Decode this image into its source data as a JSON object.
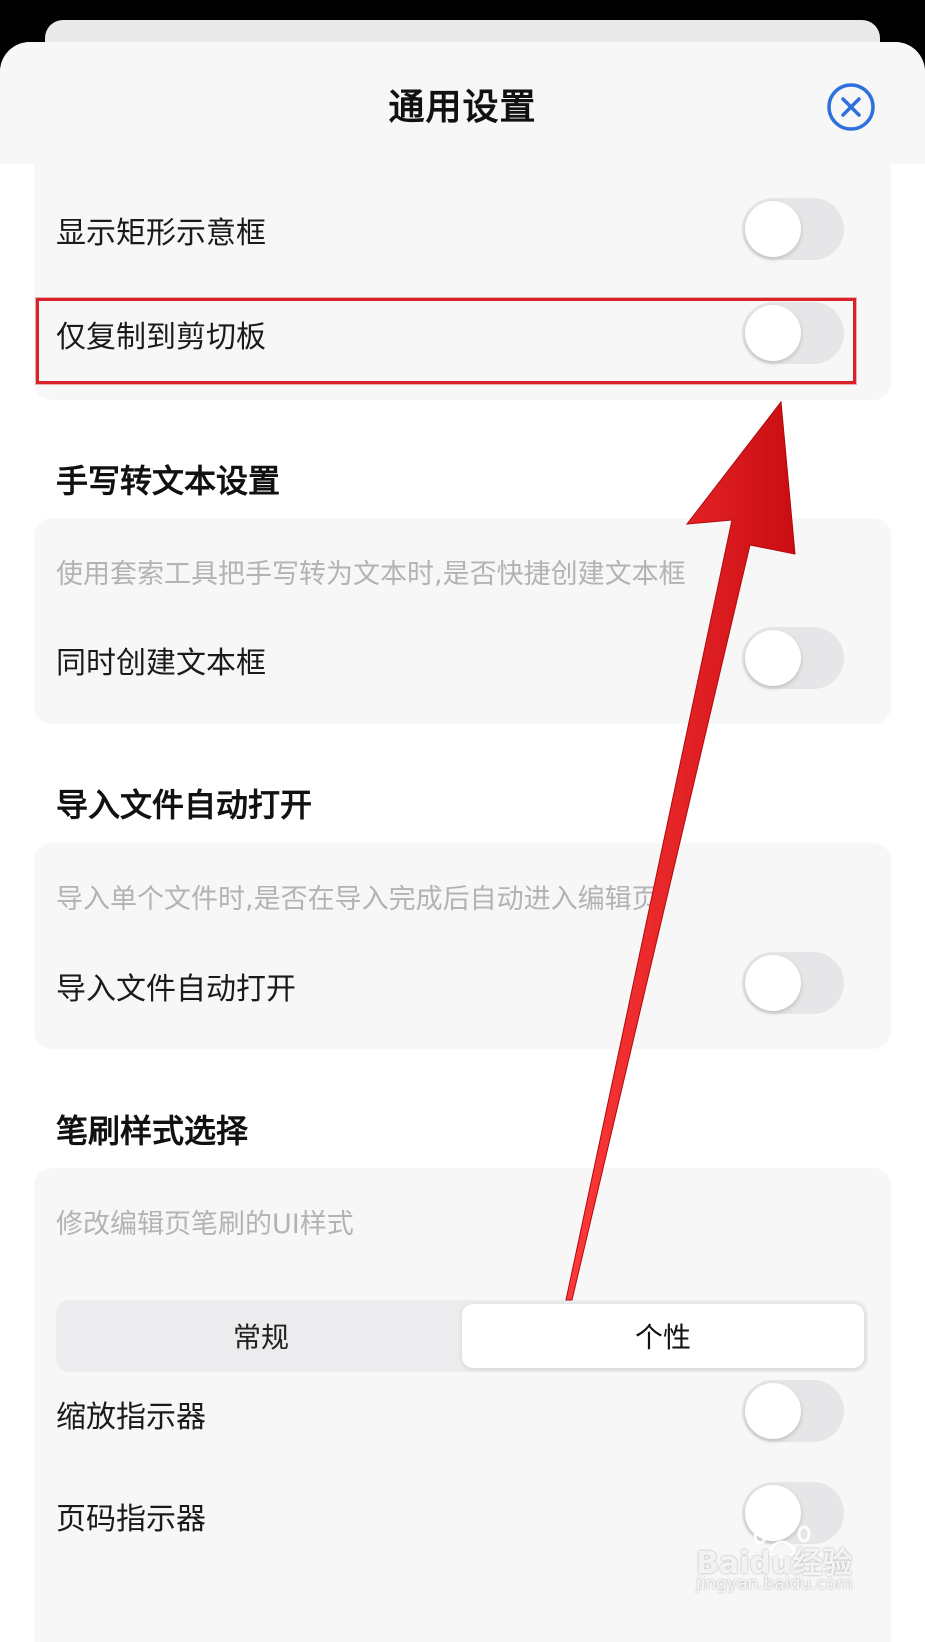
{
  "header": {
    "title": "通用设置",
    "close_icon": "close-circle-icon",
    "accent": "#2f6fde"
  },
  "card1": {
    "rows": [
      {
        "label": "显示矩形示意框",
        "toggle_on": false
      },
      {
        "label": "仅复制到剪切板",
        "toggle_on": false
      }
    ]
  },
  "handwriting": {
    "section_title": "手写转文本设置",
    "hint": "使用套索工具把手写转为文本时,是否快捷创建文本框",
    "row_label": "同时创建文本框",
    "toggle_on": false
  },
  "import": {
    "section_title": "导入文件自动打开",
    "hint": "导入单个文件时,是否在导入完成后自动进入编辑页",
    "row_label": "导入文件自动打开",
    "toggle_on": false
  },
  "brush": {
    "section_title": "笔刷样式选择",
    "hint": "修改编辑页笔刷的UI样式",
    "segments": [
      "常规",
      "个性"
    ],
    "selected": "个性",
    "zoom_label": "缩放指示器",
    "page_label": "页码指示器",
    "zoom_toggle_on": false,
    "page_toggle_on": false
  },
  "annotation": {
    "highlight_color": "#d9232a",
    "arrow_color": "#e8151b"
  },
  "watermark": {
    "brand": "Baidu经验",
    "url": "jingyan.baidu.com"
  }
}
